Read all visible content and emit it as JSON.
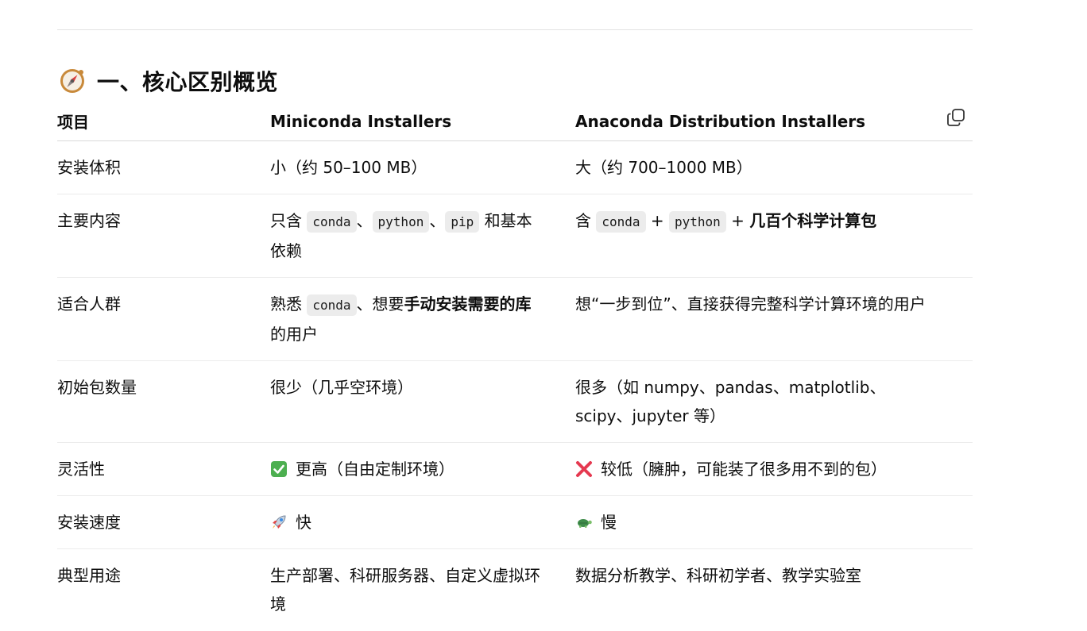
{
  "section": {
    "title": "一、核心区别概览",
    "icon": "compass-icon"
  },
  "table": {
    "headers": [
      "项目",
      "Miniconda Installers",
      "Anaconda Distribution Installers"
    ],
    "rows": {
      "size": {
        "label": "安装体积",
        "mini": "小（约 50–100 MB）",
        "ana": "大（约 700–1000 MB）"
      },
      "content": {
        "label": "主要内容",
        "mini_prefix": "只含",
        "mini_code1": "conda",
        "mini_sep1": "、",
        "mini_code2": "python",
        "mini_sep2": "、",
        "mini_code3": "pip",
        "mini_suffix": "和基本依赖",
        "ana_prefix": "含",
        "ana_code1": "conda",
        "ana_plus1": "+",
        "ana_code2": "python",
        "ana_plus2": "+",
        "ana_bold": "几百个科学计算包"
      },
      "audience": {
        "label": "适合人群",
        "mini_prefix": "熟悉",
        "mini_code": "conda",
        "mini_mid": "、想要",
        "mini_bold": "手动安装需要的库",
        "mini_suffix": "的用户",
        "ana": "想“一步到位”、直接获得完整科学计算环境的用户"
      },
      "packages": {
        "label": "初始包数量",
        "mini": "很少（几乎空环境）",
        "ana": "很多（如 numpy、pandas、matplotlib、scipy、jupyter 等）"
      },
      "flexibility": {
        "label": "灵活性",
        "mini_icon": "check-mark-icon",
        "mini": "更高（自由定制环境）",
        "ana_icon": "cross-mark-icon",
        "ana": "较低（臃肿，可能装了很多用不到的包）"
      },
      "speed": {
        "label": "安装速度",
        "mini_icon": "rocket-icon",
        "mini": "快",
        "ana_icon": "turtle-icon",
        "ana": "慢"
      },
      "usage": {
        "label": "典型用途",
        "mini": "生产部署、科研服务器、自定义虚拟环境",
        "ana": "数据分析教学、科研初学者、教学实验室"
      }
    }
  },
  "toolbar": {
    "copy_icon": "copy-icon"
  },
  "colors": {
    "check": "#4caf50",
    "cross": "#e53950",
    "code_bg": "#ececec"
  }
}
